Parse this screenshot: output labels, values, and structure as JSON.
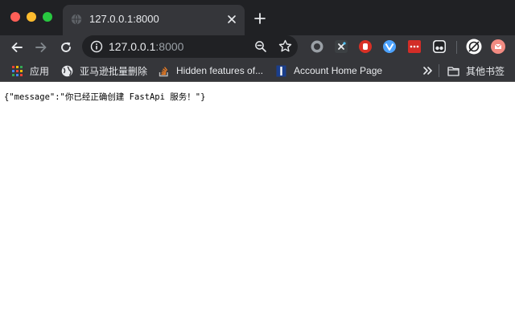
{
  "tab": {
    "title": "127.0.0.1:8000"
  },
  "address_bar": {
    "host": "127.0.0.1",
    "port": ":8000"
  },
  "bookmarks": [
    {
      "label": "应用",
      "icon": "apps-grid-icon"
    },
    {
      "label": "亚马逊批量删除",
      "icon": "globe-icon"
    },
    {
      "label": "Hidden features of...",
      "icon": "stackoverflow-icon"
    },
    {
      "label": "Account Home Page",
      "icon": "bookmark-page-icon"
    },
    {
      "label": "其他书签",
      "icon": "folder-icon"
    }
  ],
  "page": {
    "body_text": "{\"message\":\"你已经正确创建 FastApi 服务！\"}"
  },
  "colors": {
    "titlebar": "#202124",
    "toolbar": "#35363a",
    "traffic_red": "#ff5f57",
    "traffic_yellow": "#febc2e",
    "traffic_green": "#28c840"
  }
}
